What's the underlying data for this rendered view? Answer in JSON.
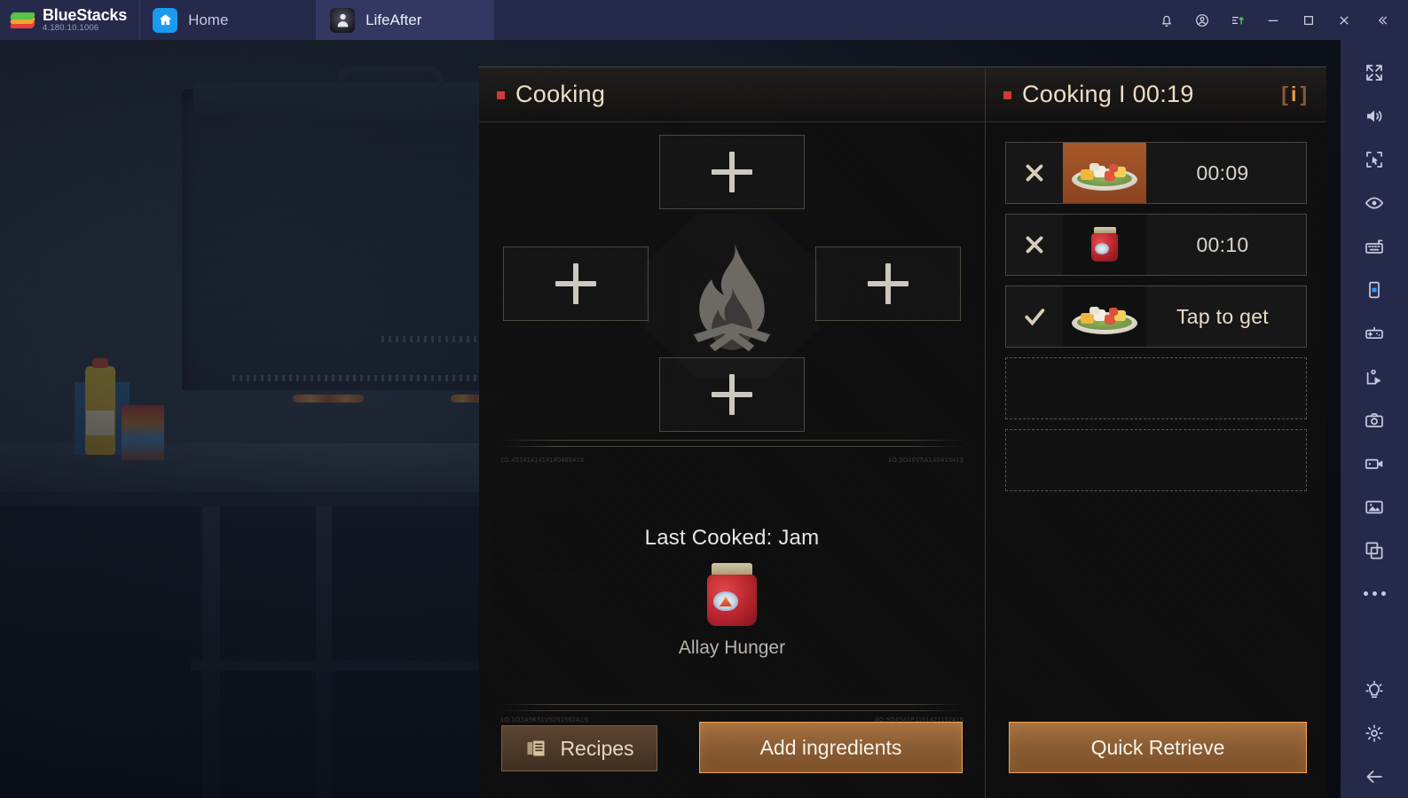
{
  "titlebar": {
    "brand_name": "BlueStacks",
    "version": "4.180.10.1006",
    "tabs": [
      {
        "label": "Home",
        "icon": "home-icon",
        "active": false
      },
      {
        "label": "LifeAfter",
        "icon": "app-avatar-icon",
        "active": true
      }
    ],
    "controls": [
      {
        "name": "notifications-button",
        "icon": "bell-icon"
      },
      {
        "name": "account-button",
        "icon": "account-circle-icon"
      },
      {
        "name": "update-button",
        "icon": "upload-arrow-icon"
      },
      {
        "name": "minimize-button",
        "icon": "minimize-icon"
      },
      {
        "name": "maximize-button",
        "icon": "maximize-icon"
      },
      {
        "name": "close-button",
        "icon": "close-icon"
      },
      {
        "name": "collapse-sidebar-button",
        "icon": "chevron-double-left-icon"
      }
    ]
  },
  "cooking_panel": {
    "title": "Cooking",
    "bullet_color": "#cf3b32",
    "slots": [
      {
        "position": "top",
        "label": "+",
        "filled": false
      },
      {
        "position": "left",
        "label": "+",
        "filled": false
      },
      {
        "position": "right",
        "label": "+",
        "filled": false
      },
      {
        "position": "bottom",
        "label": "+",
        "filled": false
      }
    ],
    "fire_icon": "campfire-icon",
    "micro_text": {
      "top_left": "1O.4514141414140465413",
      "top_right": "1O.3O16V5A1A5415413",
      "bottom_left": "1O.1O2A5K51V5251562A1S",
      "bottom_right": "4O.5O4541P1161421152415"
    },
    "last_cooked": {
      "title": "Last Cooked: Jam",
      "item_icon": "jam-jar-icon",
      "effect": "Allay Hunger"
    }
  },
  "queue_panel": {
    "title": "Cooking I 00:19",
    "bullet_color": "#cf3b32",
    "info_button": {
      "left_bracket": "[",
      "letter": "i",
      "right_bracket": "]"
    },
    "rows": [
      {
        "action_icon": "close-x-icon",
        "item_icon": "salad-plate-icon",
        "rarity": "rare",
        "status": "00:09",
        "ready": false,
        "empty": false
      },
      {
        "action_icon": "close-x-icon",
        "item_icon": "jam-jar-icon",
        "rarity": "normal",
        "status": "00:10",
        "ready": false,
        "empty": false
      },
      {
        "action_icon": "check-icon",
        "item_icon": "salad-plate-icon",
        "rarity": "normal",
        "status": "Tap to get",
        "ready": true,
        "empty": false
      },
      {
        "empty": true
      },
      {
        "empty": true
      }
    ]
  },
  "footer": {
    "recipes_label": "Recipes",
    "recipes_icon": "book-icon",
    "add_ingredients_label": "Add ingredients",
    "quick_retrieve_label": "Quick Retrieve",
    "accent_color": "#f2a35a"
  },
  "sidebar": {
    "items": [
      {
        "name": "fullscreen-button",
        "icon": "fullscreen-expand-icon"
      },
      {
        "name": "volume-button",
        "icon": "speaker-icon"
      },
      {
        "name": "select-region-button",
        "icon": "cursor-select-icon"
      },
      {
        "name": "eye-button",
        "icon": "eye-icon"
      },
      {
        "name": "keyboard-controls-button",
        "icon": "keyboard-icon"
      },
      {
        "name": "device-orientation-button",
        "icon": "phone-icon"
      },
      {
        "name": "gamepad-button",
        "icon": "gamepad-icon"
      },
      {
        "name": "script-play-button",
        "icon": "script-play-icon"
      },
      {
        "name": "screenshot-button",
        "icon": "camera-icon"
      },
      {
        "name": "record-button",
        "icon": "video-camera-icon"
      },
      {
        "name": "media-manager-button",
        "icon": "gallery-icon"
      },
      {
        "name": "multi-instance-button",
        "icon": "copy-windows-icon"
      },
      {
        "name": "more-button",
        "icon": "ellipsis-icon"
      },
      {
        "name": "tips-button",
        "icon": "lightbulb-icon"
      },
      {
        "name": "settings-button",
        "icon": "gear-icon"
      },
      {
        "name": "back-button",
        "icon": "arrow-left-icon"
      }
    ]
  }
}
